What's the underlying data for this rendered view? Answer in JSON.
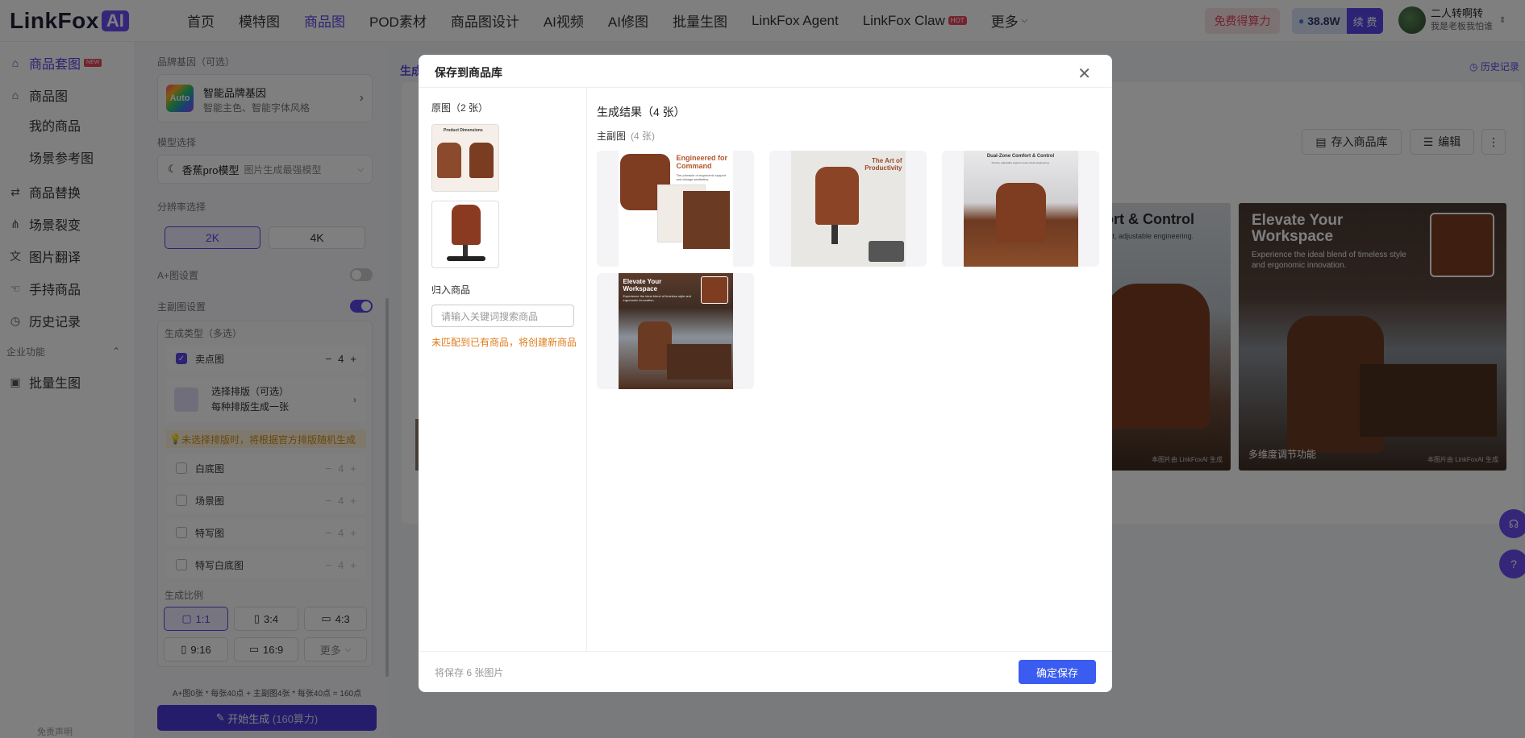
{
  "logo": {
    "text": "LinkFox",
    "badge": "AI"
  },
  "nav": {
    "items": [
      {
        "label": "首页"
      },
      {
        "label": "模特图"
      },
      {
        "label": "商品图"
      },
      {
        "label": "POD素材"
      },
      {
        "label": "商品图设计"
      },
      {
        "label": "AI视频"
      },
      {
        "label": "AI修图"
      },
      {
        "label": "批量生图"
      },
      {
        "label": "LinkFox Agent"
      },
      {
        "label": "LinkFox Claw"
      },
      {
        "label": "更多"
      }
    ],
    "hot_badge": "HOT",
    "free_button": "免费得算力",
    "credits": "38.8W",
    "renew": "续 费",
    "user_name": "二人转啊转",
    "user_sub": "我是老板我怕谁"
  },
  "sidebar": {
    "new_badge": "NEW",
    "items": [
      {
        "label": "商品套图",
        "icon": "bag-icon"
      },
      {
        "label": "商品图",
        "icon": "bag-icon"
      },
      {
        "label": "我的商品"
      },
      {
        "label": "场景参考图"
      },
      {
        "label": "商品替换",
        "icon": "swap-icon"
      },
      {
        "label": "场景裂变",
        "icon": "split-icon"
      },
      {
        "label": "图片翻译",
        "icon": "translate-icon"
      },
      {
        "label": "手持商品",
        "icon": "hand-icon"
      },
      {
        "label": "历史记录",
        "icon": "clock-icon"
      }
    ],
    "section": "企业功能",
    "batch": "批量生图",
    "disclaimer": "免责声明"
  },
  "config": {
    "brand_label": "品牌基因（可选）",
    "brand_icon": "Auto",
    "brand_title": "智能品牌基因",
    "brand_desc": "智能主色、智能字体风格",
    "model_label": "模型选择",
    "model_name": "香蕉pro模型",
    "model_desc": "图片生成最强模型",
    "res_label": "分辨率选择",
    "res_2k": "2K",
    "res_4k": "4K",
    "aplus_label": "A+图设置",
    "aplus_on": false,
    "main_label": "主副图设置",
    "main_on": true,
    "gen_type_label": "生成类型（多选）",
    "options": [
      {
        "label": "卖点图",
        "count": "4",
        "checked": true
      },
      {
        "label": "白底图",
        "count": "4",
        "checked": false
      },
      {
        "label": "场景图",
        "count": "4",
        "checked": false
      },
      {
        "label": "特写图",
        "count": "4",
        "checked": false
      },
      {
        "label": "特写白底图",
        "count": "4",
        "checked": false
      }
    ],
    "layout_title": "选择排版（可选）",
    "layout_desc": "每种排版生成一张",
    "tip": "未选择排版时，将根据官方排版随机生成",
    "ratio_label": "生成比例",
    "ratios": [
      "1:1",
      "3:4",
      "4:3",
      "9:16",
      "16:9",
      "更多"
    ],
    "formula": "A+图0张 * 每张40点 + 主副图4张 * 每张40点 = 160点",
    "generate": "开始生成",
    "generate_cost": "(160算力)"
  },
  "main": {
    "tab": "生成",
    "history": "历史记录",
    "save_lib": "存入商品库",
    "edit": "编辑",
    "bg1_title": "ort & Control",
    "bg1_sub": "ust, adjustable engineering.",
    "bg1_water": "本图片由 LinkFoxAI 生成",
    "bg2_title": "Elevate Your Workspace",
    "bg2_sub": "Experience the ideal blend of timeless style and ergonomic innovation.",
    "bg2_caption": "多维度调节功能",
    "bg2_water": "本图片由 LinkFoxAI 生成"
  },
  "modal": {
    "title": "保存到商品库",
    "originals_label": "原图（2 张）",
    "assign_label": "归入商品",
    "search_placeholder": "请输入关键词搜索商品",
    "warning": "未匹配到已有商品，将创建新商品",
    "results_label": "生成结果（4 张）",
    "main_label": "主副图",
    "main_count": "(4 张)",
    "results": [
      {
        "title": "Engineered for Command",
        "sub": "The pinnacle of ergonomic support and vintage aesthetics."
      },
      {
        "title": "The Art of Productivity",
        "sub": ""
      },
      {
        "title": "Dual-Zone Comfort & Control",
        "sub": "Precise, adjustable support meets robust engineering."
      },
      {
        "title": "Elevate Your Workspace",
        "sub": "Experience the ideal blend of timeless style and ergonomic innovation."
      }
    ],
    "orig1_label": "Product Dimensions",
    "footer": "将保存 6 张图片",
    "confirm": "确定保存"
  },
  "colors": {
    "accent": "#5b47e8",
    "confirm": "#3a5cf0",
    "warn": "#e07a1a",
    "leather": "#8b4a2b"
  }
}
